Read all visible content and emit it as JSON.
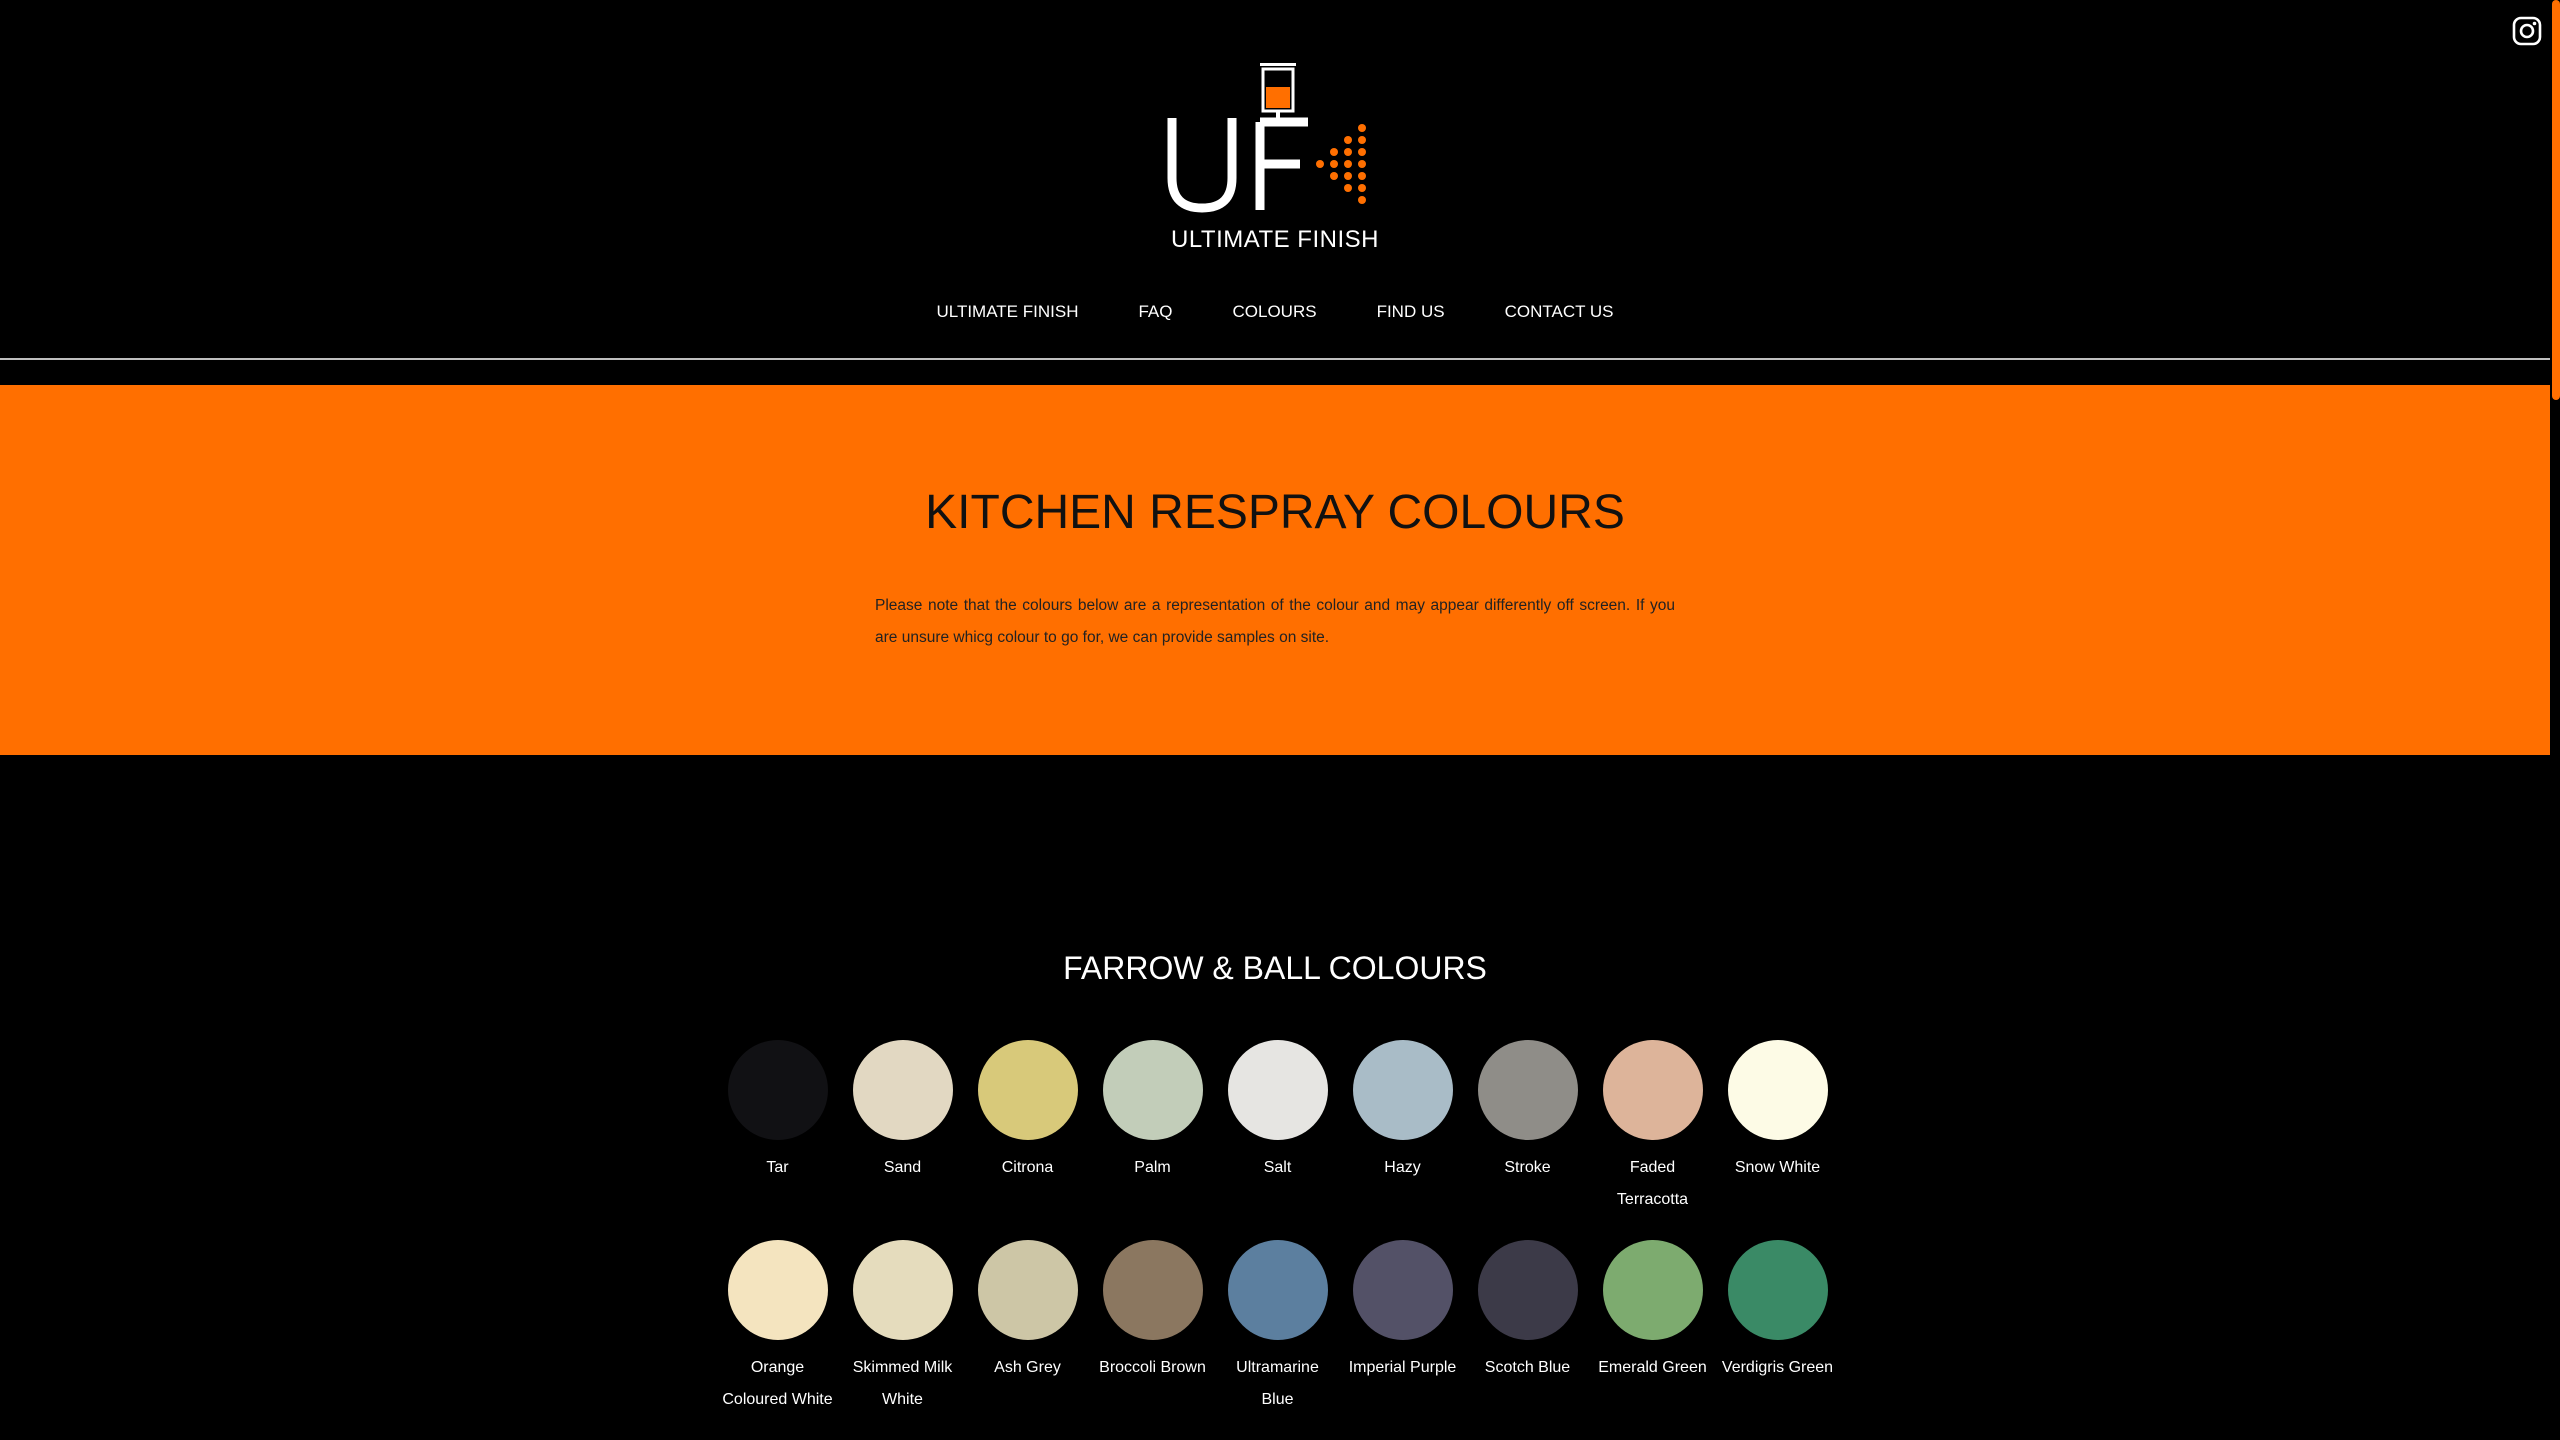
{
  "brand": {
    "name": "ULTIMATE FINISH",
    "accent": "#ff6f00"
  },
  "nav": [
    {
      "label": "ULTIMATE FINISH"
    },
    {
      "label": "FAQ"
    },
    {
      "label": "COLOURS"
    },
    {
      "label": "FIND US"
    },
    {
      "label": "CONTACT US"
    }
  ],
  "social": {
    "icon": "instagram-icon"
  },
  "hero": {
    "title": "KITCHEN RESPRAY COLOURS",
    "note": "Please note that the colours below are a representation of the colour and may appear differently off screen. If you are unsure whicg colour to go for, we can provide samples on site."
  },
  "colours": {
    "title": "FARROW & BALL COLOURS",
    "rows": [
      [
        {
          "name": "Tar",
          "color": "#111114"
        },
        {
          "name": "Sand",
          "color": "#e2d8c2"
        },
        {
          "name": "Citrona",
          "color": "#d8c97a"
        },
        {
          "name": "Palm",
          "color": "#c2cdb9"
        },
        {
          "name": "Salt",
          "color": "#e6e5e2"
        },
        {
          "name": "Hazy",
          "color": "#a9bcc7"
        },
        {
          "name": "Stroke",
          "color": "#8f8d88"
        },
        {
          "name": "Faded Terracotta",
          "color": "#ddb49a"
        },
        {
          "name": "Snow White",
          "color": "#fdfbe6"
        }
      ],
      [
        {
          "name": "Orange Coloured White",
          "color": "#f4e4bf"
        },
        {
          "name": "Skimmed Milk White",
          "color": "#e5dcbd"
        },
        {
          "name": "Ash Grey",
          "color": "#cdc6a6"
        },
        {
          "name": "Broccoli Brown",
          "color": "#8b7760"
        },
        {
          "name": "Ultramarine Blue",
          "color": "#5c7f9f"
        },
        {
          "name": "Imperial Purple",
          "color": "#535167"
        },
        {
          "name": "Scotch Blue",
          "color": "#3c3a48"
        },
        {
          "name": "Emerald Green",
          "color": "#7dab6f"
        },
        {
          "name": "Verdigris Green",
          "color": "#3a8a66"
        }
      ]
    ]
  }
}
